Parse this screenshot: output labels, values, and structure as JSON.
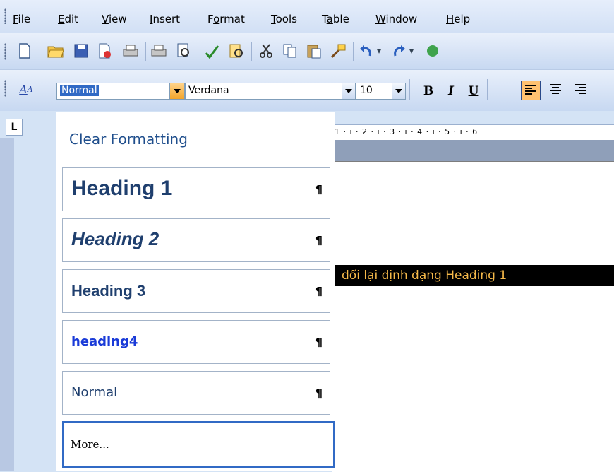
{
  "menu": {
    "items": [
      "File",
      "Edit",
      "View",
      "Insert",
      "Format",
      "Tools",
      "Table",
      "Window",
      "Help"
    ],
    "accel": [
      "F",
      "E",
      "V",
      "I",
      "o",
      "T",
      "a",
      "W",
      "H"
    ]
  },
  "toolbar": {
    "icons": [
      "new-document-icon",
      "open-folder-icon",
      "save-icon",
      "permission-icon",
      "print-icon",
      "print-icon-2",
      "print-preview-icon",
      "spelling-icon",
      "research-icon",
      "cut-icon",
      "copy-icon",
      "paste-icon",
      "format-painter-icon",
      "undo-icon",
      "redo-icon"
    ],
    "style_value": "Normal",
    "font_value": "Verdana",
    "size_value": "10",
    "bold_label": "B",
    "italic_label": "I",
    "underline_label": "U"
  },
  "ruler": {
    "text": "1 · ı · 2 · ı · 3 · ı · 4 · ı · 5 · ı · 6",
    "corner": "L"
  },
  "document": {
    "highlighted_text": "đổi lại định dạng Heading 1"
  },
  "style_panel": {
    "clear": "Clear Formatting",
    "items": [
      {
        "label": "Heading 1",
        "mark": "¶"
      },
      {
        "label": "Heading 2",
        "mark": "¶"
      },
      {
        "label": "Heading 3",
        "mark": "¶"
      },
      {
        "label": "heading4",
        "mark": "¶"
      },
      {
        "label": "Normal",
        "mark": "¶"
      }
    ],
    "more": "More..."
  },
  "colors": {
    "accent": "#316ac5",
    "heading": "#1f3f6e",
    "heading4": "#1a3bd8",
    "highlight_text": "#f5b94a"
  }
}
